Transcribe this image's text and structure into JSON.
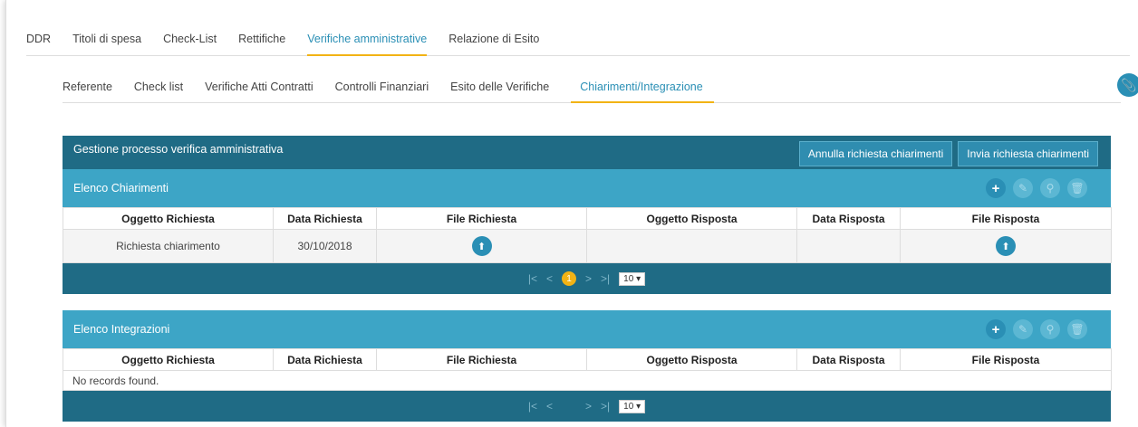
{
  "top_tabs": [
    "DDR",
    "Titoli di spesa",
    "Check-List",
    "Rettifiche",
    "Verifiche amministrative",
    "Relazione di Esito"
  ],
  "top_tabs_active": 4,
  "sub_tabs": [
    "Referente",
    "Check list",
    "Verifiche Atti Contratti",
    "Controlli Finanziari",
    "Esito delle Verifiche",
    "Chiarimenti/Integrazione"
  ],
  "sub_tabs_active": 5,
  "panel": {
    "title": "Gestione processo verifica amministrativa",
    "btn_annulla": "Annulla richiesta chiarimenti",
    "btn_invia": "Invia richiesta chiarimenti"
  },
  "columns": [
    "Oggetto Richiesta",
    "Data Richiesta",
    "File Richiesta",
    "Oggetto Risposta",
    "Data Risposta",
    "File Risposta"
  ],
  "chiarimenti": {
    "title": "Elenco Chiarimenti",
    "rows": [
      {
        "oggetto": "Richiesta chiarimento",
        "data": "30/10/2018",
        "oggetto_risposta": "",
        "data_risposta": ""
      }
    ],
    "page": "1",
    "page_size": "10 ▾"
  },
  "integrazioni": {
    "title": "Elenco Integrazioni",
    "empty": "No records found.",
    "page_size": "10 ▾"
  },
  "icons": {
    "first": "|<",
    "prev": "<",
    "next": ">",
    "last": ">|",
    "upload": "⬆",
    "add": "+",
    "edit": "✎",
    "search": "⚲",
    "delete": "🗑",
    "clip": "📎"
  }
}
